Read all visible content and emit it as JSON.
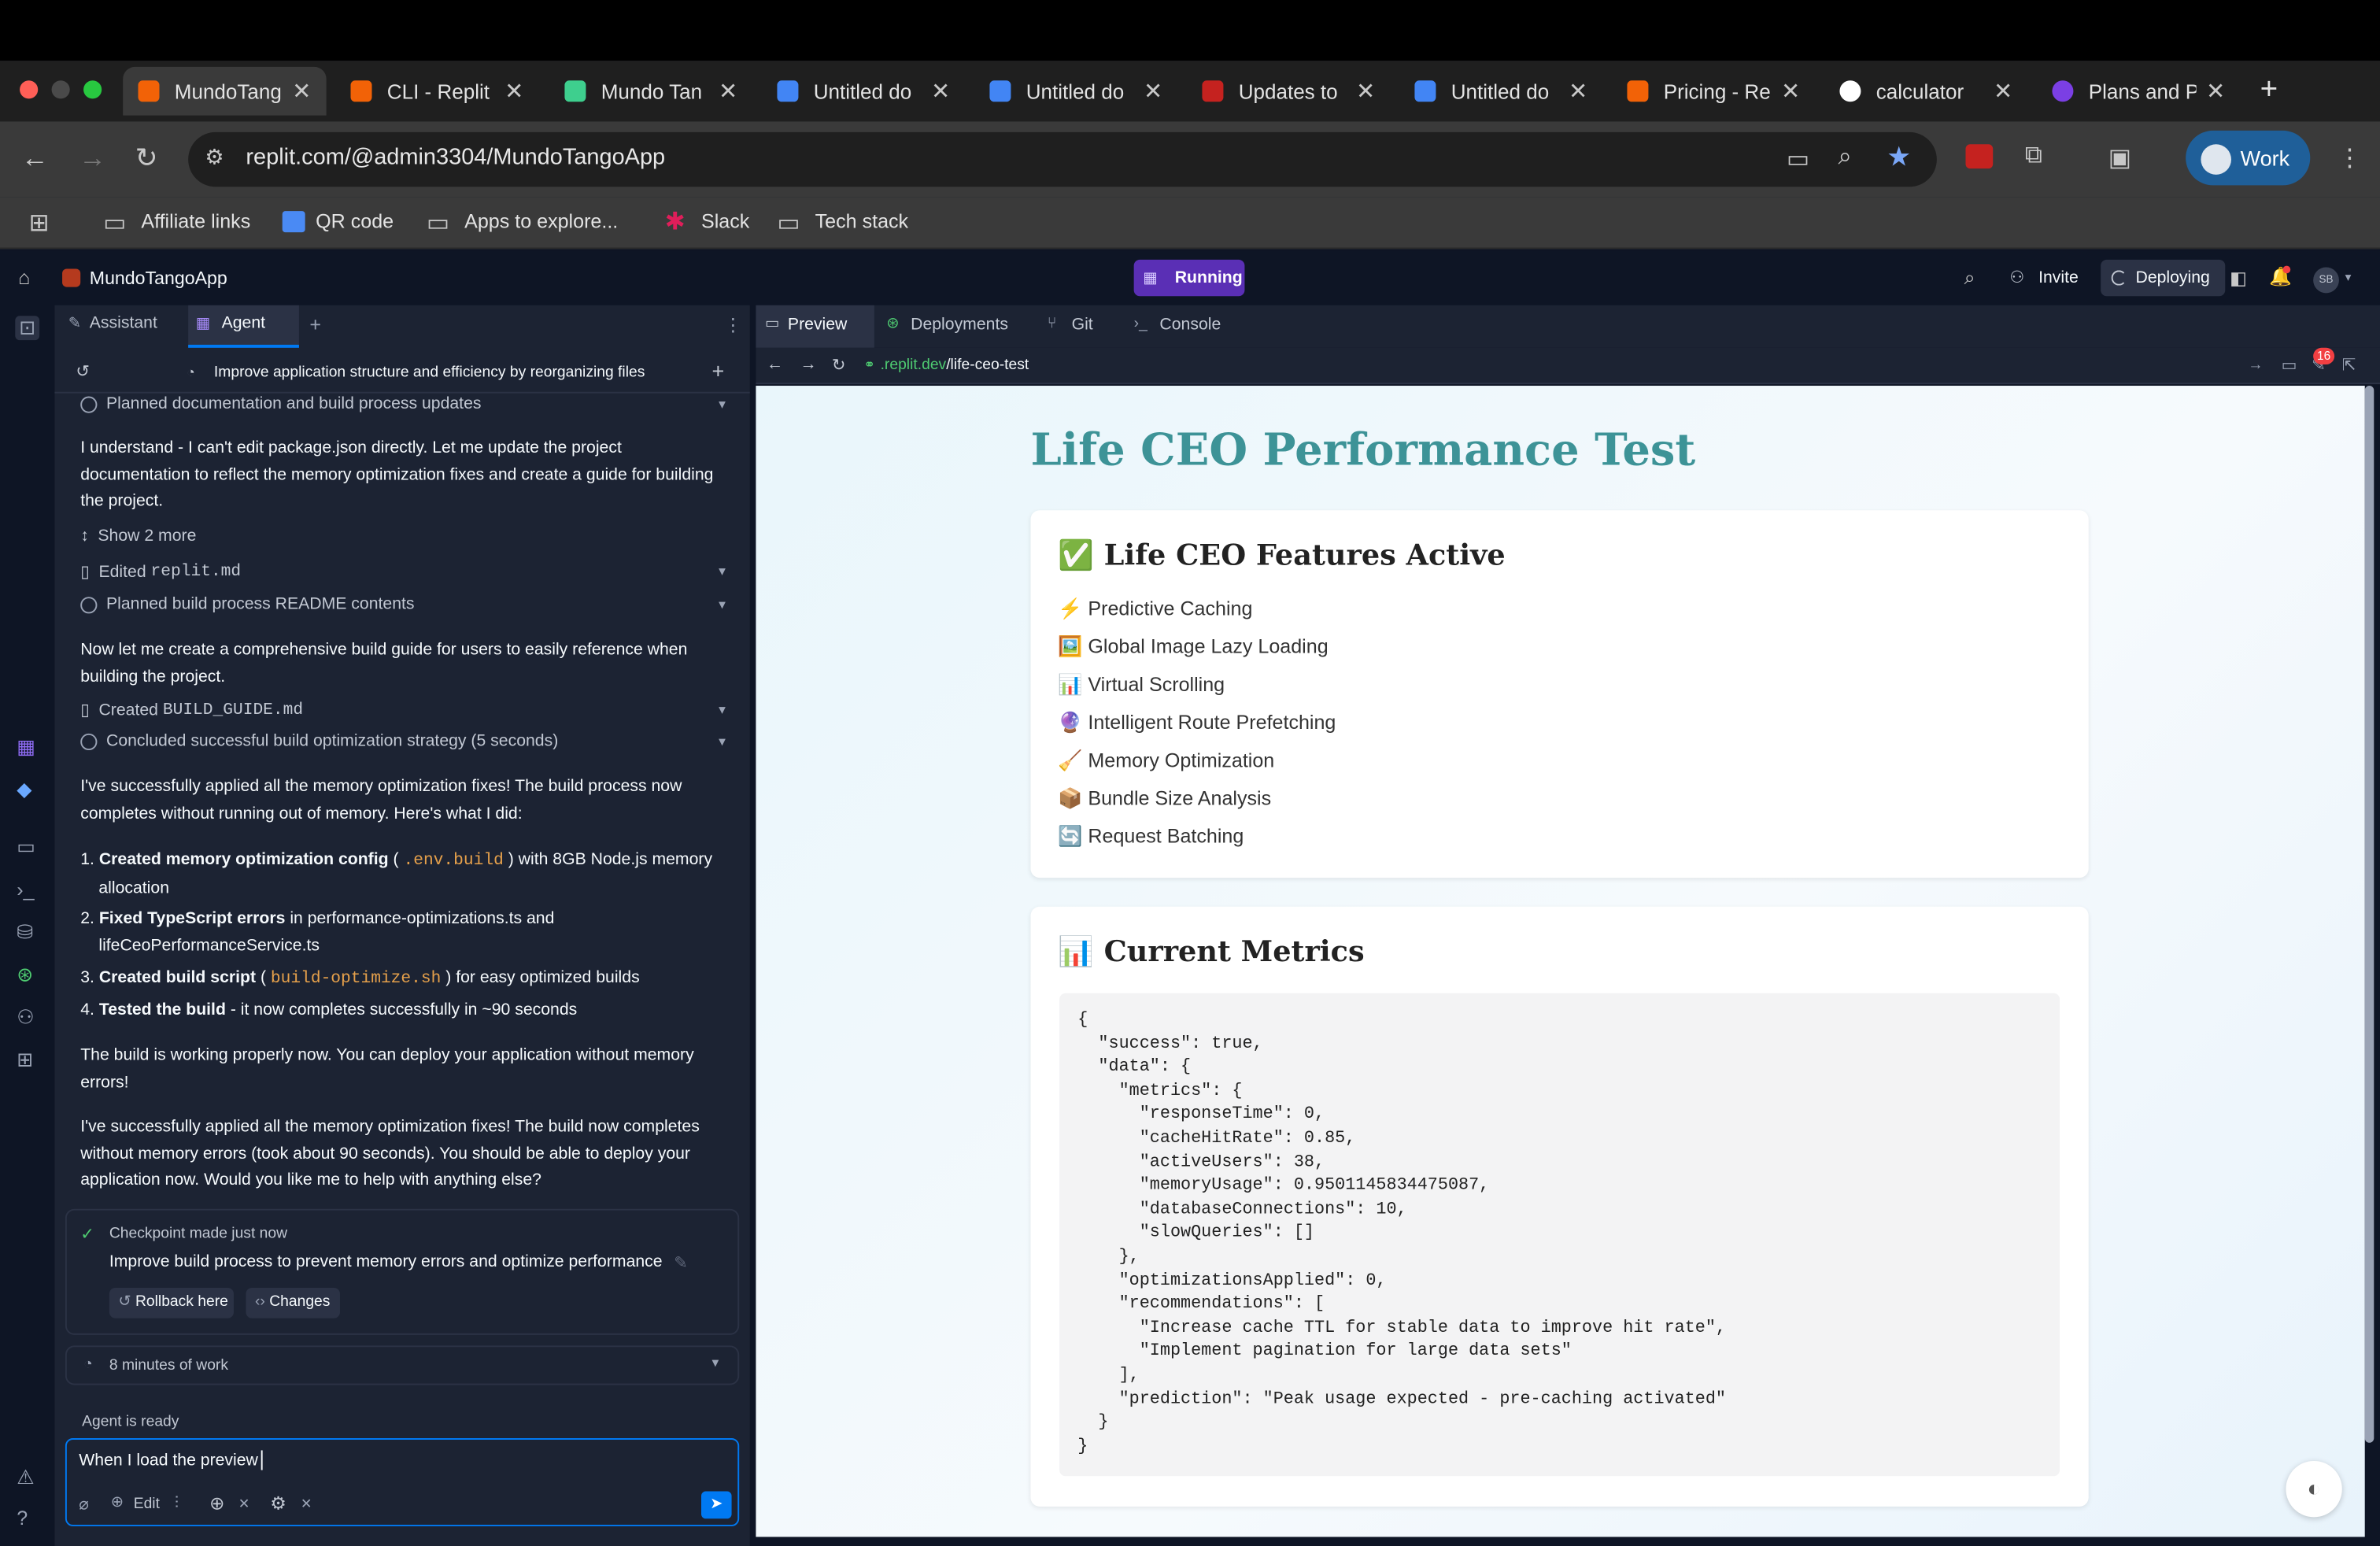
{
  "browser": {
    "tabs": [
      {
        "title": "MundoTango",
        "active": true,
        "color": "#f26207"
      },
      {
        "title": "CLI - Replit",
        "color": "#f26207"
      },
      {
        "title": "Mundo Tan",
        "color": "#3ecf8e"
      },
      {
        "title": "Untitled do",
        "color": "#4285f4"
      },
      {
        "title": "Untitled do",
        "color": "#4285f4"
      },
      {
        "title": "Updates to",
        "color": "#c5221f"
      },
      {
        "title": "Untitled do",
        "color": "#4285f4"
      },
      {
        "title": "Pricing - Re",
        "color": "#f26207"
      },
      {
        "title": "calculator",
        "color": "#ffffff"
      },
      {
        "title": "Plans and P",
        "color": "#7b3fe4"
      }
    ],
    "url": "replit.com/@admin3304/MundoTangoApp",
    "profile": "Work",
    "bookmarks": [
      "Affiliate links",
      "QR code",
      "Apps to explore...",
      "Slack",
      "Tech stack"
    ]
  },
  "replit": {
    "app_name": "MundoTangoApp",
    "status": "Running",
    "invite": "Invite",
    "deploying": "Deploying",
    "avatar": "SB",
    "left_tabs": [
      "Assistant",
      "Agent"
    ],
    "thread_title": "Improve application structure and efficiency by reorganizing files",
    "chat": {
      "row1": "Planned documentation and build process updates",
      "msg1": "I understand - I can't edit package.json directly. Let me update the project documentation to reflect the memory optimization fixes and create a guide for building the project.",
      "show_more": "Show 2 more",
      "edited_prefix": "Edited",
      "edited_file": "replit.md",
      "row2": "Planned build process README contents",
      "msg2": "Now let me create a comprehensive build guide for users to easily reference when building the project.",
      "created_prefix": "Created",
      "created_file": "BUILD_GUIDE.md",
      "row3": "Concluded successful build optimization strategy (5 seconds)",
      "msg3": "I've successfully applied all the memory optimization fixes! The build process now completes without running out of memory. Here's what I did:",
      "list": [
        {
          "num": "1.",
          "bold": "Created memory optimization config",
          "code": ".env.build",
          "rest": "with 8GB Node.js memory allocation"
        },
        {
          "num": "2.",
          "bold": "Fixed TypeScript errors",
          "rest": "in performance-optimizations.ts and lifeCeoPerformanceService.ts"
        },
        {
          "num": "3.",
          "bold": "Created build script",
          "code": "build-optimize.sh",
          "rest": "for easy optimized builds"
        },
        {
          "num": "4.",
          "bold": "Tested the build",
          "rest": "- it now completes successfully in ~90 seconds"
        }
      ],
      "msg4": "The build is working properly now. You can deploy your application without memory errors!",
      "msg5": "I've successfully applied all the memory optimization fixes! The build now completes without memory errors (took about 90 seconds). You should be able to deploy your application now. Would you like me to help with anything else?",
      "checkpoint_label": "Checkpoint made just now",
      "checkpoint_title": "Improve build process to prevent memory errors and optimize performance",
      "rollback": "Rollback here",
      "changes": "Changes",
      "work_time": "8 minutes of work",
      "agent_status": "Agent is ready",
      "input_value": "When I load the preview",
      "edit_label": "Edit"
    },
    "right_tabs": [
      "Preview",
      "Deployments",
      "Git",
      "Console"
    ],
    "preview_url_host": ".replit.dev",
    "preview_url_path": "/life-ceo-test",
    "notif_count": "16"
  },
  "preview": {
    "title": "Life CEO Performance Test",
    "features_heading": "✅ Life CEO Features Active",
    "features": [
      "⚡ Predictive Caching",
      "🖼️ Global Image Lazy Loading",
      "📊 Virtual Scrolling",
      "🔮 Intelligent Route Prefetching",
      "🧹 Memory Optimization",
      "📦 Bundle Size Analysis",
      "🔄 Request Batching"
    ],
    "metrics_heading": "📊 Current Metrics",
    "metrics_json": "{\n  \"success\": true,\n  \"data\": {\n    \"metrics\": {\n      \"responseTime\": 0,\n      \"cacheHitRate\": 0.85,\n      \"activeUsers\": 38,\n      \"memoryUsage\": 0.9501145834475087,\n      \"databaseConnections\": 10,\n      \"slowQueries\": []\n    },\n    \"optimizationsApplied\": 0,\n    \"recommendations\": [\n      \"Increase cache TTL for stable data to improve hit rate\",\n      \"Implement pagination for large data sets\"\n    ],\n    \"prediction\": \"Peak usage expected - pre-caching activated\"\n  }\n}"
  }
}
